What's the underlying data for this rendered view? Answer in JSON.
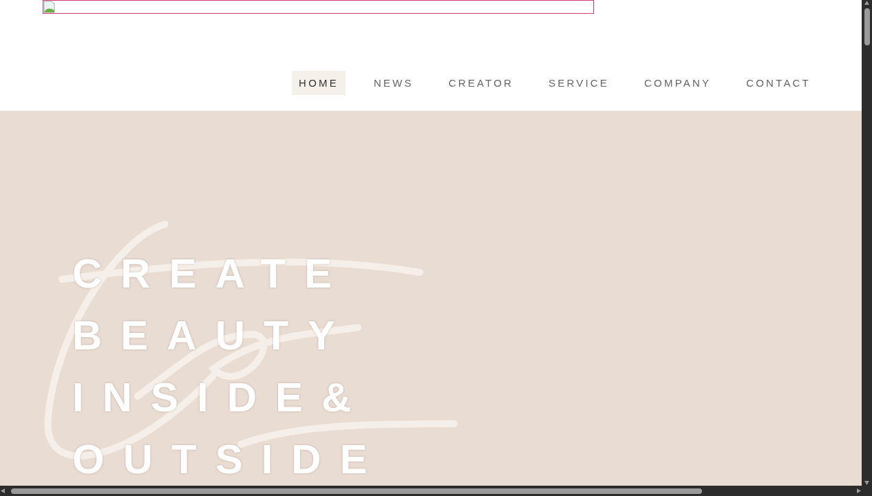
{
  "nav": [
    {
      "label": "HOME",
      "selected": true
    },
    {
      "label": "NEWS",
      "selected": false
    },
    {
      "label": "CREATOR",
      "selected": false
    },
    {
      "label": "SERVICE",
      "selected": false
    },
    {
      "label": "COMPANY",
      "selected": false
    },
    {
      "label": "CONTACT",
      "selected": false
    }
  ],
  "hero": {
    "headline": [
      "CREATE",
      "BEAUTY",
      "INSIDE&",
      "OUTSIDE"
    ]
  }
}
